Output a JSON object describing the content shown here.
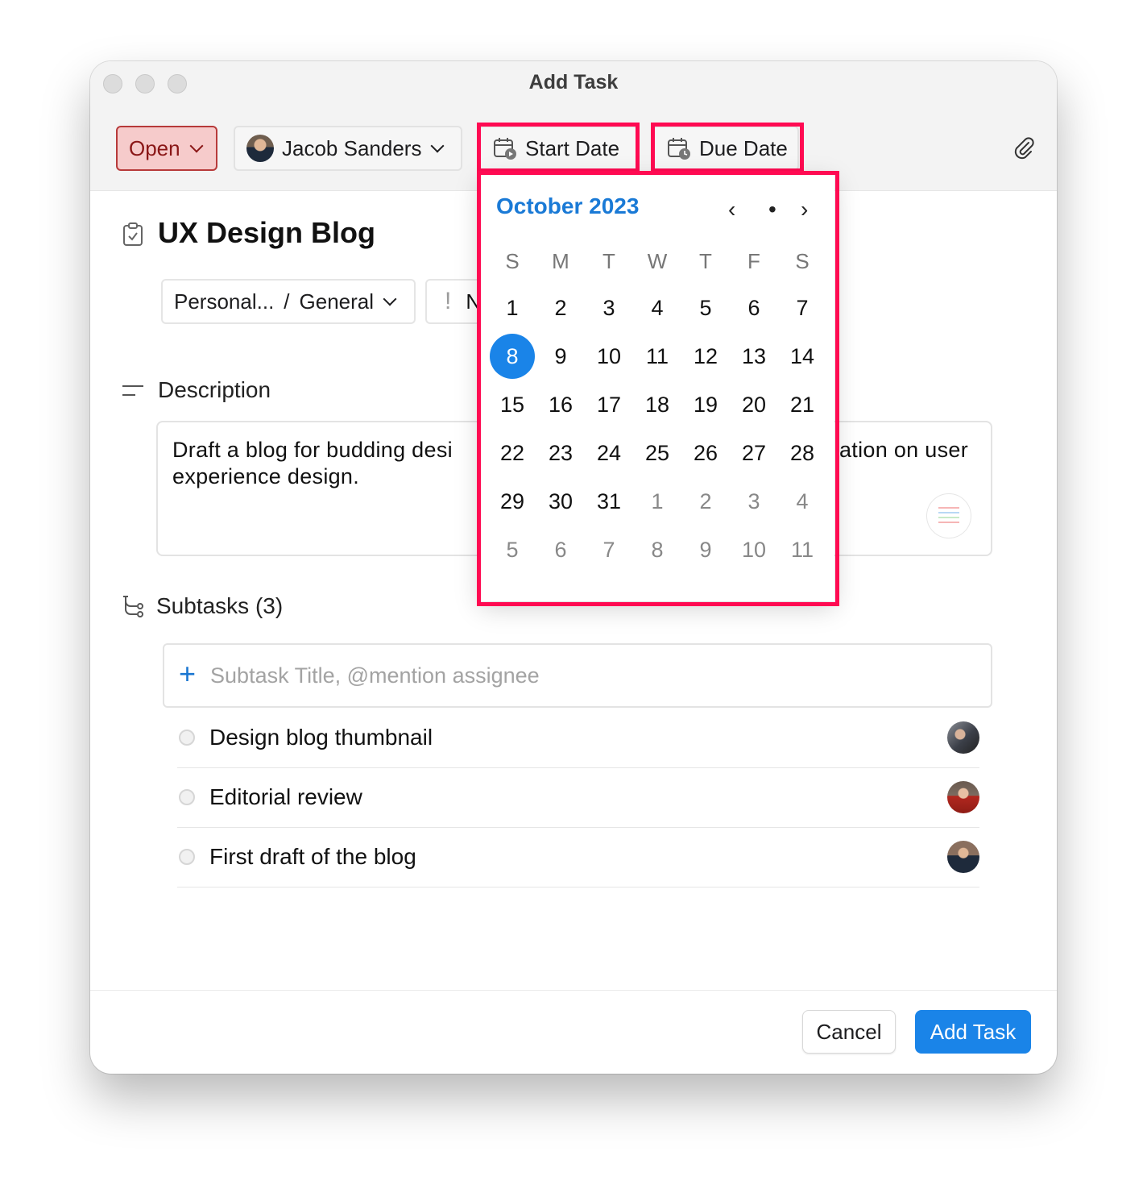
{
  "window": {
    "title": "Add Task"
  },
  "toolbar": {
    "status_label": "Open",
    "assignee_name": "Jacob Sanders",
    "start_date_label": "Start Date",
    "due_date_label": "Due Date",
    "attach_icon": "paperclip-icon"
  },
  "task": {
    "title": "UX Design Blog",
    "list_name": "Personal...",
    "list_sep": "/",
    "list_folder": "General",
    "priority_glyph": "!",
    "priority_partial": "N"
  },
  "description": {
    "label": "Description",
    "text": "Draft a blog for budding designers with tips and information on user experience design.",
    "visible_left": "Draft a blog for budding desi",
    "visible_right": "ation on user",
    "visible_line2": "experience design."
  },
  "subtasks": {
    "label": "Subtasks (3)",
    "placeholder": "Subtask Title, @mention assignee",
    "items": [
      {
        "title": "Design blog thumbnail"
      },
      {
        "title": "Editorial review"
      },
      {
        "title": "First draft of the blog"
      }
    ]
  },
  "calendar": {
    "month_label": "October 2023",
    "prev": "‹",
    "today_dot": "•",
    "next": "›",
    "weekdays": [
      "S",
      "M",
      "T",
      "W",
      "T",
      "F",
      "S"
    ],
    "weeks": [
      [
        "1",
        "2",
        "3",
        "4",
        "5",
        "6",
        "7"
      ],
      [
        "8",
        "9",
        "10",
        "11",
        "12",
        "13",
        "14"
      ],
      [
        "15",
        "16",
        "17",
        "18",
        "19",
        "20",
        "21"
      ],
      [
        "22",
        "23",
        "24",
        "25",
        "26",
        "27",
        "28"
      ],
      [
        "29",
        "30",
        "31",
        "1",
        "2",
        "3",
        "4"
      ],
      [
        "5",
        "6",
        "7",
        "8",
        "9",
        "10",
        "11"
      ]
    ],
    "selected_day": "8"
  },
  "footer": {
    "cancel_label": "Cancel",
    "add_label": "Add Task"
  },
  "colors": {
    "accent": "#1a84e8",
    "highlight": "#ff0a52",
    "status_bg": "#f6cbcb"
  }
}
